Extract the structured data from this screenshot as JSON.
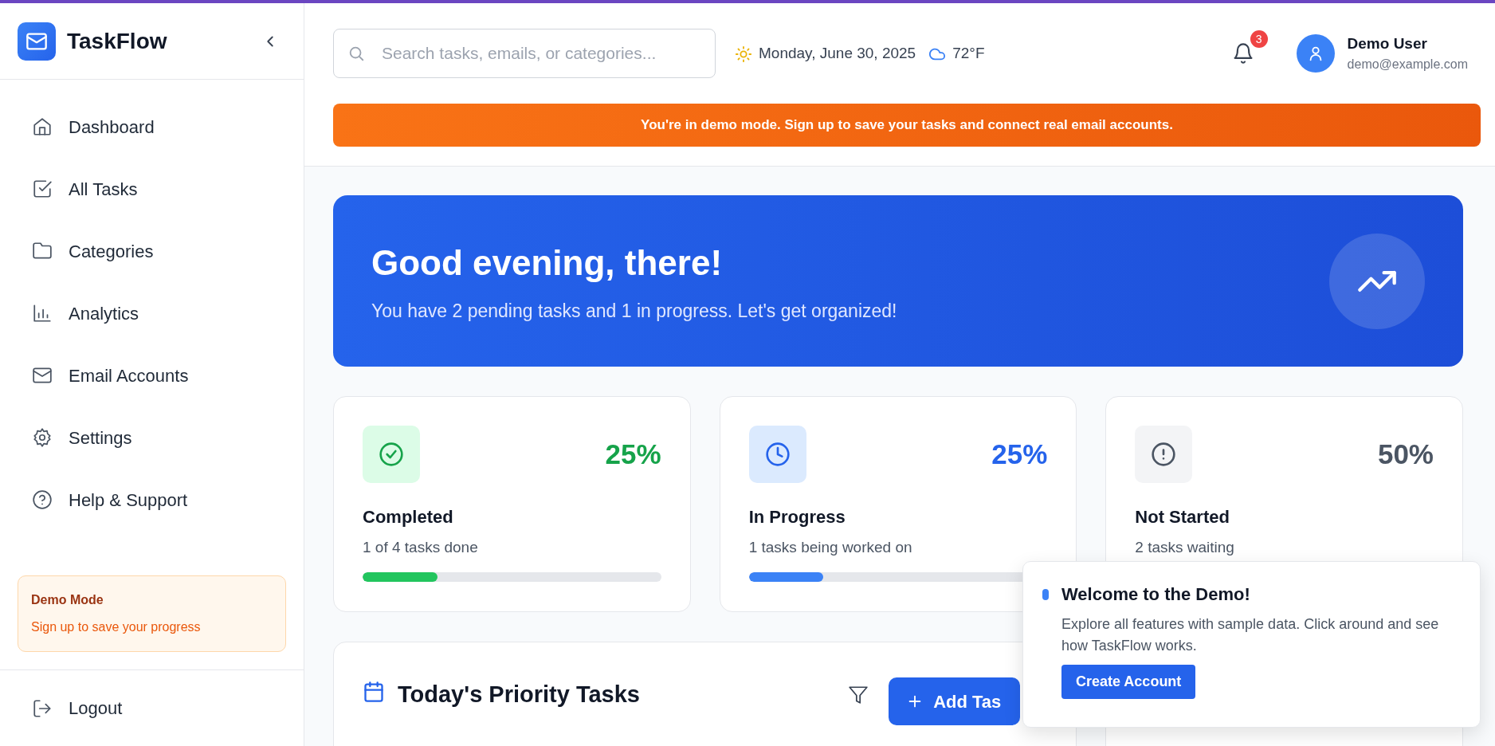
{
  "brand": {
    "name": "TaskFlow"
  },
  "sidebar": {
    "items": [
      {
        "label": "Dashboard",
        "selected": false
      },
      {
        "label": "All Tasks",
        "selected": false
      },
      {
        "label": "Categories",
        "selected": false
      },
      {
        "label": "Analytics",
        "selected": false
      },
      {
        "label": "Email Accounts",
        "selected": false
      },
      {
        "label": "Settings",
        "selected": false
      },
      {
        "label": "Help & Support",
        "selected": false
      }
    ],
    "demo_box": {
      "title": "Demo Mode",
      "text": "Sign up to save your progress"
    },
    "logout": "Logout"
  },
  "header": {
    "search": {
      "placeholder": "Search tasks, emails, or categories..."
    },
    "date": "Monday, June 30, 2025",
    "temperature": "72°F",
    "notifications": "3",
    "user": {
      "name": "Demo User",
      "email": "demo@example.com"
    }
  },
  "banner": "You're in demo mode. Sign up to save your tasks and connect real email accounts.",
  "hero": {
    "title": "Good evening, there!",
    "subtitle": "You have 2 pending tasks and 1 in progress. Let's get organized!"
  },
  "stats": [
    {
      "kind": "completed",
      "percent": "25%",
      "title": "Completed",
      "text": "1 of 4 tasks done",
      "level": 0.25
    },
    {
      "kind": "progress",
      "percent": "25%",
      "title": "In Progress",
      "text": "1 tasks being worked on",
      "level": 0.25
    },
    {
      "kind": "waiting",
      "percent": "50%",
      "title": "Not Started",
      "text": "2 tasks waiting"
    }
  ],
  "priority": {
    "title": "Today's Priority Tasks",
    "add_button": "Add Tas"
  },
  "toast": {
    "title": "Welcome to the Demo!",
    "text": "Explore all features with sample data. Click around and see how TaskFlow works.",
    "button": "Create Account"
  }
}
